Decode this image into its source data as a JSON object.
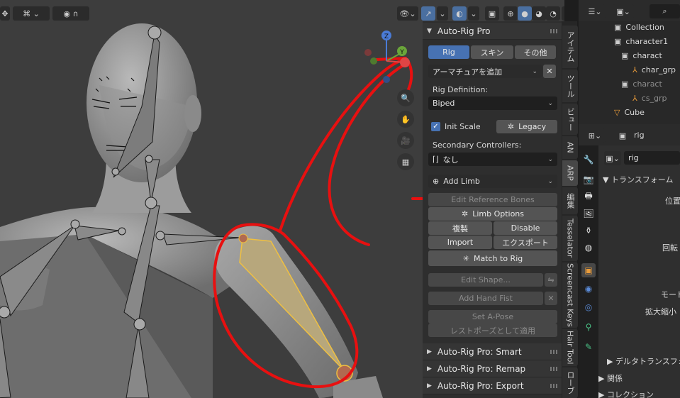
{
  "viewport": {
    "header_icons": [
      "transform-tool-icon",
      "snap-icon",
      "proportional-icon"
    ],
    "gizmo": {
      "z_label": "Z",
      "y_label": "Y"
    }
  },
  "sidebar_tabs": [
    "アイテム",
    "ツール",
    "ビュー",
    "AN",
    "ARP",
    "編集",
    "Tesselator",
    "Screencast Keys",
    "Hair Tool",
    "ローブ"
  ],
  "arp": {
    "title": "Auto-Rig Pro",
    "tabs": [
      "Rig",
      "スキン",
      "その他"
    ],
    "active_tab": "Rig",
    "add_armature": "アーマチュアを追加",
    "rig_definition_label": "Rig Definition:",
    "rig_definition_value": "Biped",
    "init_scale": "Init Scale",
    "legacy": "Legacy",
    "secondary_label": "Secondary Controllers:",
    "secondary_value": "なし",
    "add_limb": "Add Limb",
    "edit_reference_bones": "Edit Reference Bones",
    "limb_options": "Limb Options",
    "duplicate": "複製",
    "disable": "Disable",
    "import": "Import",
    "export": "エクスポート",
    "match_to_rig": "Match to Rig",
    "edit_shape": "Edit Shape...",
    "add_hand_fist": "Add Hand Fist",
    "set_a_pose": "Set A-Pose",
    "apply_rest_pose": "レストポーズとして適用"
  },
  "subpanels": [
    "Auto-Rig Pro: Smart",
    "Auto-Rig Pro: Remap",
    "Auto-Rig Pro: Export"
  ],
  "outliner": {
    "rows": [
      {
        "label": "Collection",
        "indent": 1,
        "dim": false
      },
      {
        "label": "character1",
        "indent": 1,
        "dim": false
      },
      {
        "label": "charact",
        "indent": 2,
        "dim": false
      },
      {
        "label": "char_grp",
        "indent": 3,
        "dim": false
      },
      {
        "label": "charact",
        "indent": 2,
        "dim": true
      },
      {
        "label": "cs_grp",
        "indent": 3,
        "dim": true
      },
      {
        "label": "Cube",
        "indent": 1,
        "dim": false
      }
    ]
  },
  "properties": {
    "object_name": "rig",
    "name_field": "rig",
    "transform": "トランスフォーム",
    "location": "位置",
    "rotation": "回転",
    "mode": "モード",
    "scale": "拡大縮小",
    "delta": "デルタトランスフォーム",
    "relations": "関係",
    "collections": "コレクション"
  },
  "colors": {
    "annotation": "#e81010",
    "selected_bone": "#c9b17c",
    "accent": "#4772b3"
  }
}
